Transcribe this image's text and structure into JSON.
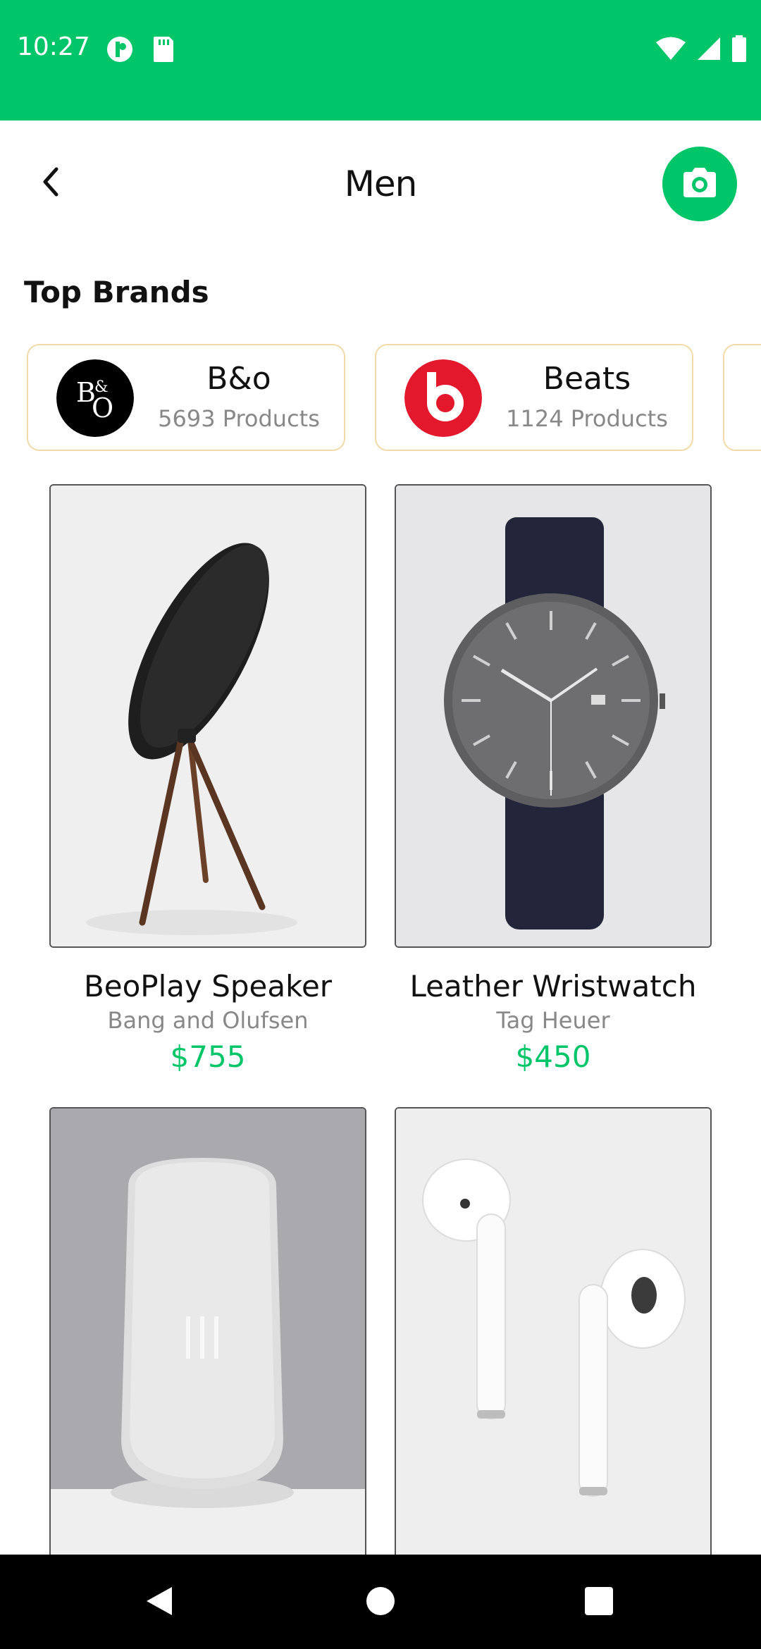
{
  "status_bar": {
    "time": "10:27",
    "background": "#00c569"
  },
  "header": {
    "title": "Men",
    "back_icon": "back-arrow-icon",
    "camera_icon": "camera-icon"
  },
  "section": {
    "title": "Top Brands"
  },
  "brands": [
    {
      "name": "B&o",
      "count": "5693 Products",
      "logo": "bo-logo-icon"
    },
    {
      "name": "Beats",
      "count": "1124 Products",
      "logo": "beats-logo-icon"
    }
  ],
  "products": [
    {
      "name": "BeoPlay Speaker",
      "brand": "Bang and Olufsen",
      "price": "$755",
      "image": "speaker-image"
    },
    {
      "name": "Leather Wristwatch",
      "brand": "Tag Heuer",
      "price": "$450",
      "image": "watch-image"
    },
    {
      "name": "",
      "brand": "",
      "price": "",
      "image": "smart-speaker-image"
    },
    {
      "name": "",
      "brand": "",
      "price": "",
      "image": "earbuds-image"
    }
  ],
  "colors": {
    "accent": "#00c569",
    "brand_border": "#f3d9a8",
    "muted_text": "#888888"
  }
}
